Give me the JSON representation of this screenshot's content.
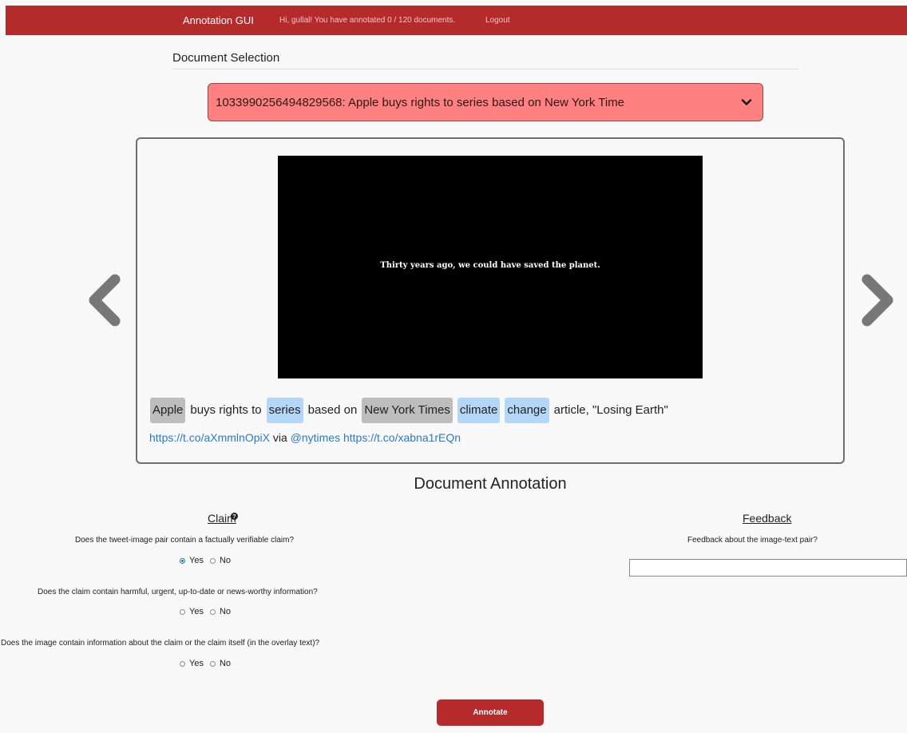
{
  "navbar": {
    "brand": "Annotation GUI",
    "greeting": "Hi, gullal! You have annotated 0 / 120 documents.",
    "logout": "Logout",
    "color": "#b52a2a"
  },
  "document_selection": {
    "title": "Document Selection",
    "selected": "1033990256494829568: Apple buys rights to series based on New York Time",
    "chevron_icon": "chevron-down-icon"
  },
  "document": {
    "image_overlay_text": "Thirty years ago, we could have saved the planet.",
    "tweet_tokens": [
      {
        "text": "Apple",
        "highlight": "grey"
      },
      {
        "text": "buys rights to",
        "highlight": "none"
      },
      {
        "text": "series",
        "highlight": "blue"
      },
      {
        "text": "based on",
        "highlight": "none"
      },
      {
        "text": "New York Times",
        "highlight": "grey"
      },
      {
        "text": "climate",
        "highlight": "blue"
      },
      {
        "text": "change",
        "highlight": "blue"
      },
      {
        "text": "article, \"Losing Earth\"",
        "highlight": "none"
      }
    ],
    "links": {
      "link1": "https://t.co/aXmmlnOpiX",
      "via": "via",
      "handle": "@nytimes",
      "link2": "https://t.co/xabna1rEQn"
    },
    "prev_icon": "chevron-left-icon",
    "next_icon": "chevron-right-icon"
  },
  "annotation": {
    "title": "Document Annotation",
    "claim": {
      "heading": "Claim",
      "help_icon": "question-circle-icon",
      "questions": [
        {
          "text": "Does the tweet-image pair contain a factually verifiable claim?",
          "yes": "Yes",
          "no": "No",
          "selected": "yes"
        },
        {
          "text": "Does the claim contain harmful, urgent, up-to-date or news-worthy information?",
          "yes": "Yes",
          "no": "No",
          "selected": null
        },
        {
          "text": "Does the image contain information about the claim or the claim itself (in the overlay text)?",
          "yes": "Yes",
          "no": "No",
          "selected": null
        }
      ]
    },
    "feedback": {
      "heading": "Feedback",
      "question": "Feedback about the image-text pair?",
      "value": ""
    },
    "submit_label": "Annotate"
  }
}
